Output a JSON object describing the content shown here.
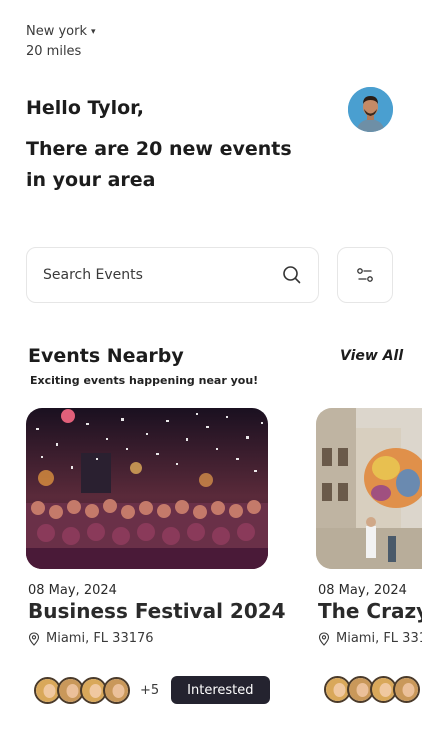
{
  "location": {
    "city": "New york",
    "radius": "20 miles"
  },
  "greeting": {
    "hello": "Hello Tylor,",
    "headline": "There are 20 new events in your area"
  },
  "search": {
    "placeholder": "Search Events"
  },
  "icons": {
    "search": "search-icon",
    "filter": "filter-icon",
    "location": "location-pin-icon",
    "dropdown": "dropdown-dot-icon"
  },
  "section": {
    "title": "Events Nearby",
    "subtitle": "Exciting events happening near you!",
    "view_all": "View All"
  },
  "events": [
    {
      "date": "08 May, 2024",
      "title": "Business Festival 2024",
      "location": "Miami, FL 33176",
      "extra_attendees": "+5",
      "action": "Interested"
    },
    {
      "date": "08 May, 2024",
      "title": "The Crazy",
      "location": "Miami, FL 331"
    }
  ],
  "colors": {
    "button_dark": "#24232f",
    "text_primary": "#1c1c1c",
    "border": "#e6e6e6",
    "avatar_bg": "#4a9fd0"
  }
}
